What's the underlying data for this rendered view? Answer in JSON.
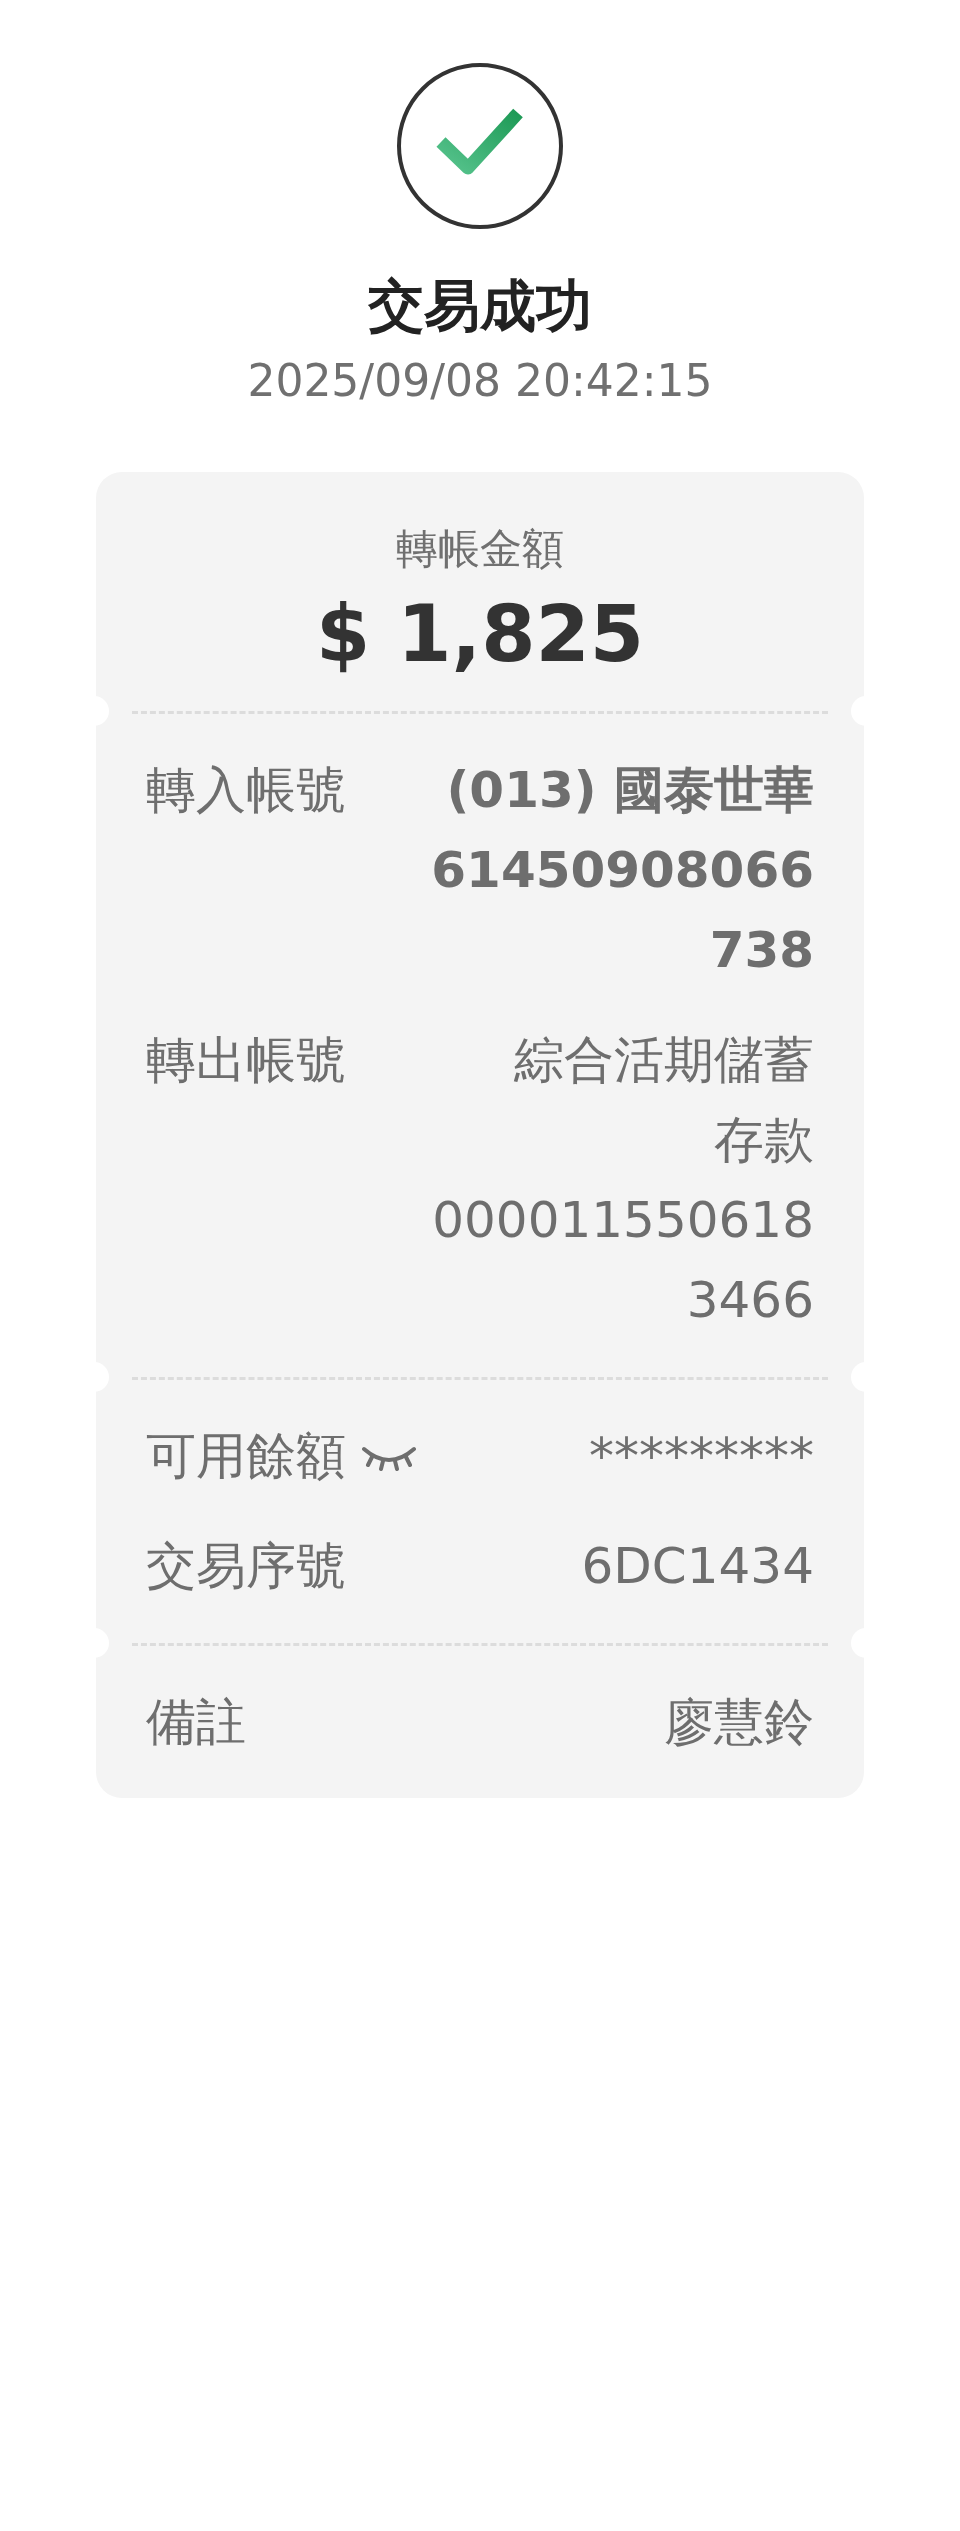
{
  "status": {
    "title": "交易成功",
    "datetime": "2025/09/08 20:42:15"
  },
  "amount": {
    "label": "轉帳金額",
    "value": "$ 1,825"
  },
  "sections": [
    {
      "rows": [
        {
          "kind": "plain",
          "label": "轉入帳號",
          "bold": true,
          "lines": [
            "(013) 國泰世華",
            "61450908066",
            "738"
          ]
        },
        {
          "kind": "plain",
          "label": "轉出帳號",
          "bold": false,
          "lines": [
            "綜合活期儲蓄",
            "存款",
            "000011550618",
            "3466"
          ]
        }
      ]
    },
    {
      "rows": [
        {
          "kind": "balance",
          "label": "可用餘額",
          "bold": false,
          "lines": [
            "*********"
          ]
        },
        {
          "kind": "plain",
          "label": "交易序號",
          "bold": false,
          "lines": [
            "6DC1434"
          ]
        }
      ]
    },
    {
      "rows": [
        {
          "kind": "plain",
          "label": "備註",
          "bold": false,
          "lines": [
            "廖慧鈴"
          ]
        }
      ]
    }
  ]
}
